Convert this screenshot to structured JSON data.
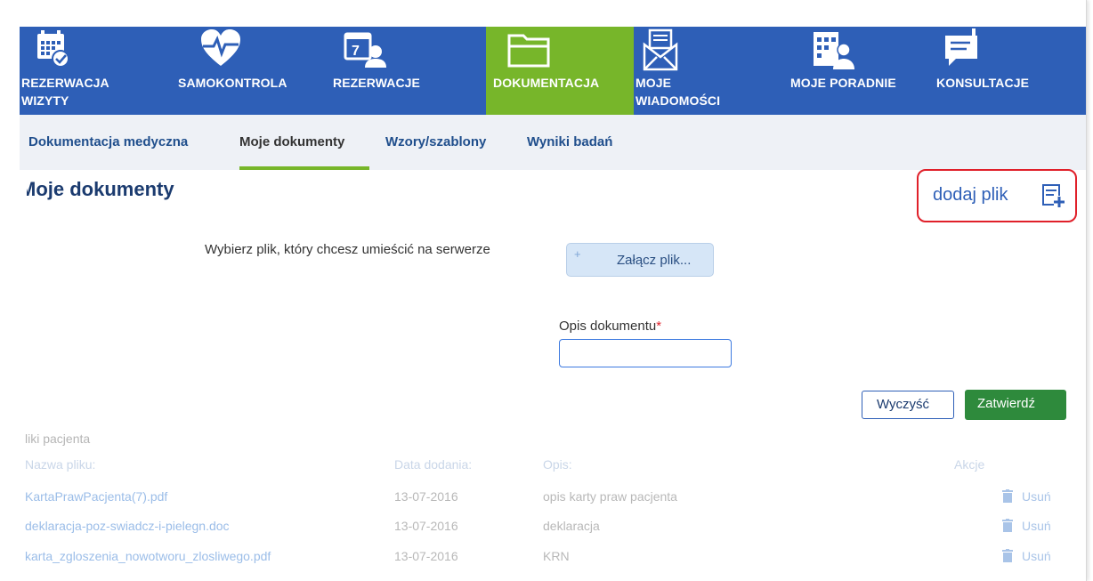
{
  "nav": {
    "items": [
      {
        "label": "REZERWACJA WIZYTY",
        "icon": "calendar-check-icon",
        "active": false
      },
      {
        "label": "SAMOKONTROLA",
        "icon": "heart-pulse-icon",
        "active": false
      },
      {
        "label": "REZERWACJE",
        "icon": "calendar-person-icon",
        "active": false
      },
      {
        "label": "DOKUMENTACJA",
        "icon": "folder-icon",
        "active": true
      },
      {
        "label": "MOJE WIADOMOŚCI",
        "icon": "envelope-icon",
        "active": false
      },
      {
        "label": "MOJE PORADNIE",
        "icon": "hospital-icon",
        "active": false
      },
      {
        "label": "KONSULTACJE",
        "icon": "chat-bubble-icon",
        "active": false
      }
    ]
  },
  "subnav": {
    "tabs": [
      {
        "label": "Dokumentacja medyczna"
      },
      {
        "label": "Moje dokumenty"
      },
      {
        "label": "Wzory/szablony"
      },
      {
        "label": "Wyniki badań"
      }
    ]
  },
  "page": {
    "title": "Moje dokumenty",
    "add_file": "dodaj plik",
    "choose_label": "Wybierz plik, który chcesz umieścić na serwerze",
    "attach_button": "Załącz plik...",
    "attach_plus": "+",
    "desc_label": "Opis dokumentu",
    "required_mark": "*",
    "desc_value": "",
    "clear_button": "Wyczyść",
    "submit_button": "Zatwierdź"
  },
  "files": {
    "title": "liki pacjenta",
    "headers": {
      "name": "Nazwa pliku:",
      "date": "Data dodania:",
      "desc": "Opis:",
      "actions": "Akcje"
    },
    "rows": [
      {
        "name": "KartaPrawPacjenta(7).pdf",
        "date": "13-07-2016",
        "desc": "opis karty praw pacjenta",
        "action": "Usuń"
      },
      {
        "name": "deklaracja-poz-swiadcz-i-pielegn.doc",
        "date": "13-07-2016",
        "desc": "deklaracja",
        "action": "Usuń"
      },
      {
        "name": "karta_zgloszenia_nowotworu_zlosliwego.pdf",
        "date": "13-07-2016",
        "desc": "KRN",
        "action": "Usuń"
      }
    ]
  },
  "colors": {
    "nav_bg": "#2e5fb7",
    "nav_active": "#77b62a",
    "subnav_bg": "#eef1f6",
    "submit": "#2e8a3c",
    "highlight": "#e0202a"
  }
}
